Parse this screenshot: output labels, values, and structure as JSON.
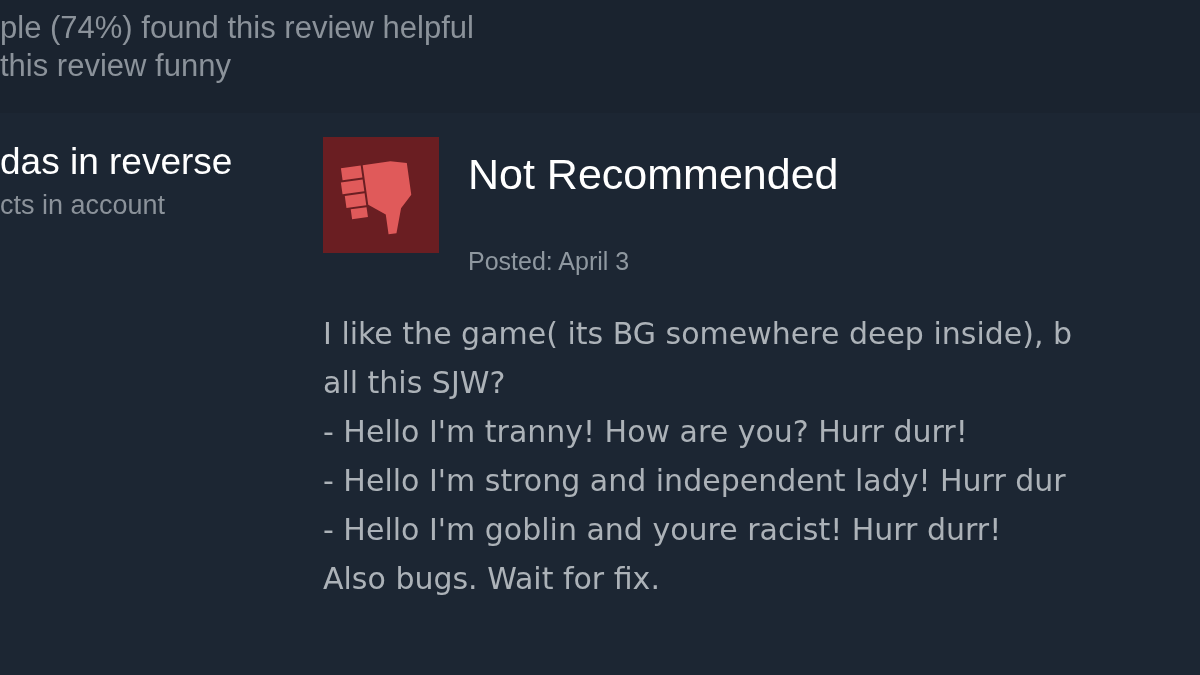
{
  "helpfulness": [
    "ple (74%) found this review helpful",
    "this review funny"
  ],
  "reviewer": {
    "name": "das in reverse",
    "products": "cts in account"
  },
  "review": {
    "verdict": {
      "kind": "not_recommended",
      "label": "Not Recommended"
    },
    "posted": "Posted: April 3",
    "body": [
      "I like the game( its BG somewhere deep inside), b",
      "all this SJW?",
      "- Hello I'm tranny! How are you? Hurr durr!",
      "- Hello I'm strong and independent lady! Hurr dur",
      "- Hello I'm goblin and youre racist! Hurr durr!",
      "Also bugs. Wait for fix."
    ]
  }
}
